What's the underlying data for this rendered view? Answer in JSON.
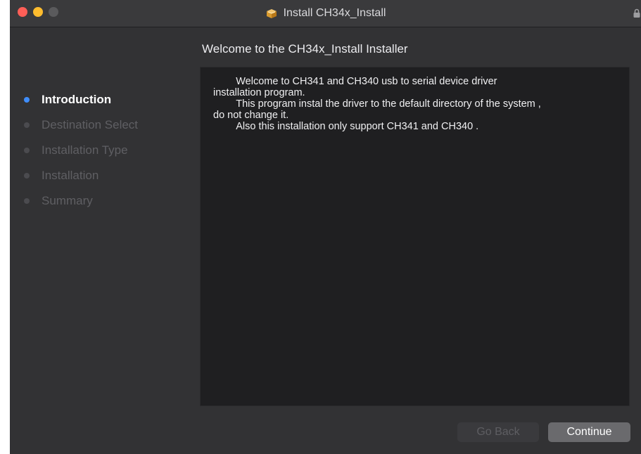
{
  "window": {
    "title": "Install CH34x_Install",
    "heading": "Welcome to the CH34x_Install Installer"
  },
  "sidebar": {
    "items": [
      {
        "label": "Introduction",
        "active": true
      },
      {
        "label": "Destination Select",
        "active": false
      },
      {
        "label": "Installation Type",
        "active": false
      },
      {
        "label": "Installation",
        "active": false
      },
      {
        "label": "Summary",
        "active": false
      }
    ]
  },
  "content": {
    "text": "        Welcome to CH341 and CH340 usb to serial device driver\ninstallation program.\n        This program instal the driver to the default directory of the system ,\ndo not change it.\n        Also this installation only support CH341 and CH340 ."
  },
  "buttons": {
    "back": "Go Back",
    "continue": "Continue"
  },
  "colors": {
    "window_bg": "#323234",
    "content_bg": "#1f1f21",
    "accent": "#3f8dfa"
  },
  "icons": {
    "package": "package-icon",
    "lock": "lock-icon"
  }
}
